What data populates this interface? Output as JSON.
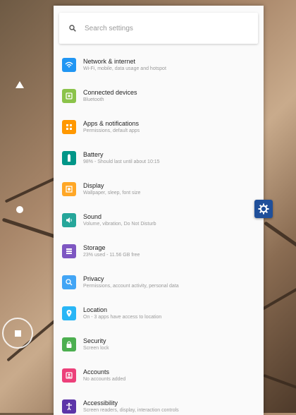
{
  "search": {
    "placeholder": "Search settings"
  },
  "settings": [
    {
      "title": "Network & internet",
      "subtitle": "Wi-Fi, mobile, data usage and hotspot",
      "icon": "wifi-icon",
      "color": "#2196f3"
    },
    {
      "title": "Connected devices",
      "subtitle": "Bluetooth",
      "icon": "devices-icon",
      "color": "#8bc34a"
    },
    {
      "title": "Apps & notifications",
      "subtitle": "Permissions, default apps",
      "icon": "apps-icon",
      "color": "#ff9800"
    },
    {
      "title": "Battery",
      "subtitle": "98% - Should last until about 10:15",
      "icon": "battery-icon",
      "color": "#009688"
    },
    {
      "title": "Display",
      "subtitle": "Wallpaper, sleep, font size",
      "icon": "display-icon",
      "color": "#ffa726"
    },
    {
      "title": "Sound",
      "subtitle": "Volume, vibration, Do Not Disturb",
      "icon": "sound-icon",
      "color": "#26a69a"
    },
    {
      "title": "Storage",
      "subtitle": "23% used - 11.56 GB free",
      "icon": "storage-icon",
      "color": "#7e57c2"
    },
    {
      "title": "Privacy",
      "subtitle": "Permissions, account activity, personal data",
      "icon": "privacy-icon",
      "color": "#42a5f5"
    },
    {
      "title": "Location",
      "subtitle": "On - 3 apps have access to location",
      "icon": "location-icon",
      "color": "#29b6f6"
    },
    {
      "title": "Security",
      "subtitle": "Screen lock",
      "icon": "security-icon",
      "color": "#4caf50"
    },
    {
      "title": "Accounts",
      "subtitle": "No accounts added",
      "icon": "accounts-icon",
      "color": "#ec407a"
    },
    {
      "title": "Accessibility",
      "subtitle": "Screen readers, display, interaction controls",
      "icon": "accessibility-icon",
      "color": "#5c35a8"
    }
  ],
  "nav": {
    "back_icon": "back-icon",
    "home_icon": "home-icon",
    "recents_icon": "recents-icon"
  },
  "fab": {
    "icon": "settings-gear-icon",
    "color": "#1f4f9a"
  }
}
